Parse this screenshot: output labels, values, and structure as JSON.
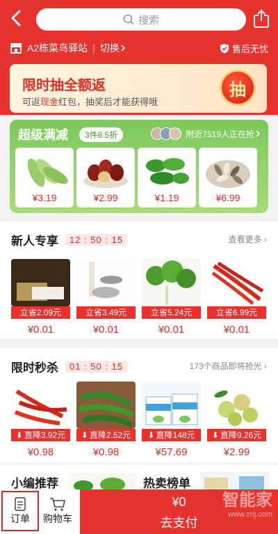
{
  "header": {
    "search_placeholder": "搜索",
    "store_name": "A2栋菜鸟驿站",
    "switch_label": "切换",
    "after_sale": "售后无忧"
  },
  "lottery": {
    "title": "限时抽全额返",
    "desc_prefix": "可返",
    "desc_highlight": "现金",
    "desc_suffix": "红包，抽奖后才能获得哦",
    "button": "抽"
  },
  "super_deal": {
    "title": "超级满减",
    "tag": "3件8.5折",
    "people": "附近7519人正在抢",
    "items": [
      {
        "name": "cucumber",
        "price": "¥3.19"
      },
      {
        "name": "jujube",
        "price": "¥2.99"
      },
      {
        "name": "green-pepper",
        "price": "¥1.19"
      },
      {
        "name": "sunflower-seeds",
        "price": "¥6.99"
      }
    ]
  },
  "new_user": {
    "title": "新人专享",
    "timer": "12 : 50 : 15",
    "more": "查看更多",
    "products": [
      {
        "badge": "立省2.09元",
        "price": "¥0.01"
      },
      {
        "badge": "立省3.49元",
        "price": "¥0.01"
      },
      {
        "badge": "立省5.24元",
        "price": "¥0.01"
      },
      {
        "badge": "立省6.99元",
        "price": "¥0.01"
      }
    ]
  },
  "flash_sale": {
    "title": "限时秒杀",
    "timer": "01 : 50 : 15",
    "more": "173个商品即将抢光",
    "products": [
      {
        "badge": "直降3.92元",
        "price": "¥0.98"
      },
      {
        "badge": "直降2.52元",
        "price": "¥0.98"
      },
      {
        "badge": "直降148元",
        "price": "¥57.69"
      },
      {
        "badge": "直降9.26元",
        "price": "¥2.99"
      }
    ]
  },
  "bottom_sections": {
    "editor_pick": "小编推荐",
    "hot_list": "热卖榜单"
  },
  "tabbar": {
    "orders": "订单",
    "cart": "购物车",
    "total": "¥0",
    "pay": "去支付"
  },
  "watermark": {
    "brand": "智能家",
    "url": "www.znj.com"
  },
  "colors": {
    "primary": "#e8322d",
    "green": "#7cc95b"
  }
}
